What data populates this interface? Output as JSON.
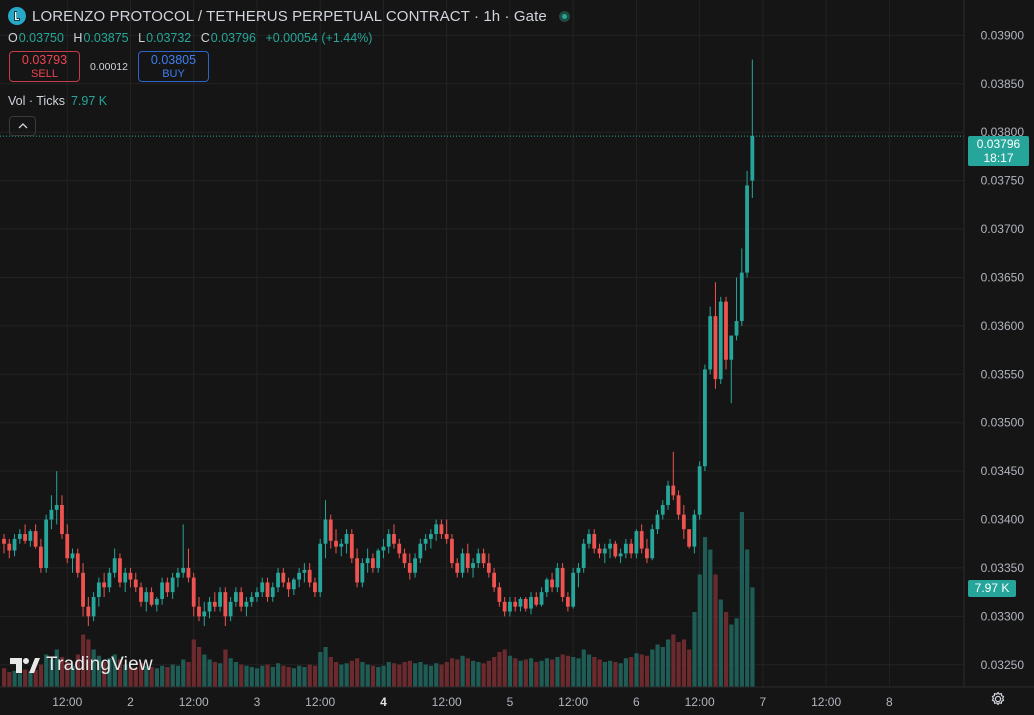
{
  "header": {
    "title": "LORENZO PROTOCOL / TETHERUS PERPETUAL CONTRACT · 1h · Gate"
  },
  "ohlc": {
    "o_label": "O",
    "o": "0.03750",
    "h_label": "H",
    "h": "0.03875",
    "l_label": "L",
    "l": "0.03732",
    "c_label": "C",
    "c": "0.03796",
    "change": "+0.00054 (+1.44%)"
  },
  "trade": {
    "sell_price": "0.03793",
    "sell_label": "SELL",
    "spread": "0.00012",
    "buy_price": "0.03805",
    "buy_label": "BUY"
  },
  "volume_legend": {
    "label": "Vol · Ticks",
    "value": "7.97 K"
  },
  "price_badge": {
    "price": "0.03796",
    "countdown": "18:17"
  },
  "volume_badge": "7.97 K",
  "brand": "TradingView",
  "colors": {
    "up": "#26a69a",
    "down": "#ef5350",
    "background": "#151515",
    "grid": "#232323"
  },
  "icons": [
    "logo-icon",
    "live-status-icon",
    "collapse-chevron-icon",
    "tradingview-logo-icon",
    "settings-gear-icon"
  ],
  "chart_data": {
    "type": "candlestick",
    "interval": "1h",
    "y_axis": {
      "ticks": [
        "0.03250",
        "0.03300",
        "0.03350",
        "0.03400",
        "0.03450",
        "0.03500",
        "0.03550",
        "0.03600",
        "0.03650",
        "0.03700",
        "0.03750",
        "0.03800",
        "0.03850",
        "0.03900"
      ],
      "range": [
        0.0321,
        0.0392
      ]
    },
    "x_axis": {
      "ticks": [
        {
          "label": "12:00",
          "bar": 12
        },
        {
          "label": "2",
          "bar": 24
        },
        {
          "label": "12:00",
          "bar": 36
        },
        {
          "label": "3",
          "bar": 48
        },
        {
          "label": "12:00",
          "bar": 60
        },
        {
          "label": "4",
          "bar": 72
        },
        {
          "label": "12:00",
          "bar": 84
        },
        {
          "label": "5",
          "bar": 96
        },
        {
          "label": "12:00",
          "bar": 108
        },
        {
          "label": "6",
          "bar": 120
        },
        {
          "label": "12:00",
          "bar": 132
        },
        {
          "label": "7",
          "bar": 144
        },
        {
          "label": "12:00",
          "bar": 156
        },
        {
          "label": "8",
          "bar": 168
        }
      ],
      "bold_tick": "4"
    },
    "grid": true,
    "last_price": 0.03796,
    "series": [
      {
        "o": 0.0338,
        "h": 0.03385,
        "l": 0.03365,
        "c": 0.03375,
        "v": 150
      },
      {
        "o": 0.03375,
        "h": 0.0338,
        "l": 0.0336,
        "c": 0.03368,
        "v": 120
      },
      {
        "o": 0.03368,
        "h": 0.03385,
        "l": 0.03362,
        "c": 0.0338,
        "v": 130
      },
      {
        "o": 0.0338,
        "h": 0.0339,
        "l": 0.03375,
        "c": 0.03385,
        "v": 110
      },
      {
        "o": 0.03385,
        "h": 0.03395,
        "l": 0.03375,
        "c": 0.03378,
        "v": 140
      },
      {
        "o": 0.03378,
        "h": 0.0339,
        "l": 0.03372,
        "c": 0.03388,
        "v": 125
      },
      {
        "o": 0.03388,
        "h": 0.03395,
        "l": 0.0337,
        "c": 0.03372,
        "v": 135
      },
      {
        "o": 0.03372,
        "h": 0.0338,
        "l": 0.03345,
        "c": 0.0335,
        "v": 180
      },
      {
        "o": 0.0335,
        "h": 0.03405,
        "l": 0.03345,
        "c": 0.034,
        "v": 260
      },
      {
        "o": 0.034,
        "h": 0.03425,
        "l": 0.0339,
        "c": 0.0341,
        "v": 220
      },
      {
        "o": 0.0341,
        "h": 0.0345,
        "l": 0.03395,
        "c": 0.03415,
        "v": 300
      },
      {
        "o": 0.03415,
        "h": 0.03425,
        "l": 0.0338,
        "c": 0.03385,
        "v": 240
      },
      {
        "o": 0.03385,
        "h": 0.03395,
        "l": 0.03355,
        "c": 0.0336,
        "v": 200
      },
      {
        "o": 0.0336,
        "h": 0.0337,
        "l": 0.03345,
        "c": 0.03365,
        "v": 170
      },
      {
        "o": 0.03365,
        "h": 0.0337,
        "l": 0.0334,
        "c": 0.03345,
        "v": 260
      },
      {
        "o": 0.03345,
        "h": 0.03355,
        "l": 0.033,
        "c": 0.0331,
        "v": 420
      },
      {
        "o": 0.0331,
        "h": 0.0332,
        "l": 0.0329,
        "c": 0.033,
        "v": 380
      },
      {
        "o": 0.033,
        "h": 0.03325,
        "l": 0.03295,
        "c": 0.0332,
        "v": 300
      },
      {
        "o": 0.0332,
        "h": 0.0334,
        "l": 0.0331,
        "c": 0.03335,
        "v": 250
      },
      {
        "o": 0.03335,
        "h": 0.03345,
        "l": 0.0332,
        "c": 0.0333,
        "v": 200
      },
      {
        "o": 0.0333,
        "h": 0.0335,
        "l": 0.03325,
        "c": 0.03345,
        "v": 230
      },
      {
        "o": 0.03345,
        "h": 0.0337,
        "l": 0.0334,
        "c": 0.0336,
        "v": 260
      },
      {
        "o": 0.0336,
        "h": 0.03365,
        "l": 0.0333,
        "c": 0.03335,
        "v": 220
      },
      {
        "o": 0.03335,
        "h": 0.0335,
        "l": 0.03325,
        "c": 0.03345,
        "v": 180
      },
      {
        "o": 0.03345,
        "h": 0.0335,
        "l": 0.0333,
        "c": 0.03338,
        "v": 160
      },
      {
        "o": 0.03338,
        "h": 0.03345,
        "l": 0.03325,
        "c": 0.0333,
        "v": 150
      },
      {
        "o": 0.0333,
        "h": 0.03335,
        "l": 0.0331,
        "c": 0.03315,
        "v": 190
      },
      {
        "o": 0.03315,
        "h": 0.0333,
        "l": 0.03305,
        "c": 0.03325,
        "v": 170
      },
      {
        "o": 0.03325,
        "h": 0.0333,
        "l": 0.0331,
        "c": 0.03312,
        "v": 160
      },
      {
        "o": 0.03312,
        "h": 0.0332,
        "l": 0.03305,
        "c": 0.03318,
        "v": 150
      },
      {
        "o": 0.03318,
        "h": 0.0334,
        "l": 0.03312,
        "c": 0.03335,
        "v": 170
      },
      {
        "o": 0.03335,
        "h": 0.0334,
        "l": 0.0332,
        "c": 0.03325,
        "v": 160
      },
      {
        "o": 0.03325,
        "h": 0.03345,
        "l": 0.03318,
        "c": 0.0334,
        "v": 180
      },
      {
        "o": 0.0334,
        "h": 0.0335,
        "l": 0.0333,
        "c": 0.03345,
        "v": 170
      },
      {
        "o": 0.03345,
        "h": 0.03395,
        "l": 0.0334,
        "c": 0.0335,
        "v": 220
      },
      {
        "o": 0.0335,
        "h": 0.0337,
        "l": 0.03335,
        "c": 0.0334,
        "v": 200
      },
      {
        "o": 0.0334,
        "h": 0.03345,
        "l": 0.033,
        "c": 0.0331,
        "v": 380
      },
      {
        "o": 0.0331,
        "h": 0.0332,
        "l": 0.03295,
        "c": 0.033,
        "v": 320
      },
      {
        "o": 0.033,
        "h": 0.03315,
        "l": 0.0329,
        "c": 0.03305,
        "v": 260
      },
      {
        "o": 0.03305,
        "h": 0.0332,
        "l": 0.03298,
        "c": 0.03315,
        "v": 220
      },
      {
        "o": 0.03315,
        "h": 0.03325,
        "l": 0.03305,
        "c": 0.0331,
        "v": 200
      },
      {
        "o": 0.0331,
        "h": 0.0333,
        "l": 0.03305,
        "c": 0.03325,
        "v": 190
      },
      {
        "o": 0.03325,
        "h": 0.0333,
        "l": 0.0329,
        "c": 0.033,
        "v": 300
      },
      {
        "o": 0.033,
        "h": 0.0332,
        "l": 0.03295,
        "c": 0.03315,
        "v": 230
      },
      {
        "o": 0.03315,
        "h": 0.0333,
        "l": 0.0331,
        "c": 0.03325,
        "v": 200
      },
      {
        "o": 0.03325,
        "h": 0.0333,
        "l": 0.03305,
        "c": 0.0331,
        "v": 180
      },
      {
        "o": 0.0331,
        "h": 0.0332,
        "l": 0.033,
        "c": 0.03315,
        "v": 170
      },
      {
        "o": 0.03315,
        "h": 0.03325,
        "l": 0.0331,
        "c": 0.0332,
        "v": 160
      },
      {
        "o": 0.0332,
        "h": 0.0333,
        "l": 0.03315,
        "c": 0.03325,
        "v": 150
      },
      {
        "o": 0.03325,
        "h": 0.0334,
        "l": 0.0332,
        "c": 0.03335,
        "v": 170
      },
      {
        "o": 0.03335,
        "h": 0.0334,
        "l": 0.03315,
        "c": 0.0332,
        "v": 180
      },
      {
        "o": 0.0332,
        "h": 0.03335,
        "l": 0.03315,
        "c": 0.0333,
        "v": 160
      },
      {
        "o": 0.0333,
        "h": 0.0335,
        "l": 0.03325,
        "c": 0.03345,
        "v": 190
      },
      {
        "o": 0.03345,
        "h": 0.0335,
        "l": 0.0333,
        "c": 0.03335,
        "v": 170
      },
      {
        "o": 0.03335,
        "h": 0.0334,
        "l": 0.0332,
        "c": 0.03328,
        "v": 160
      },
      {
        "o": 0.03328,
        "h": 0.0334,
        "l": 0.03322,
        "c": 0.03338,
        "v": 150
      },
      {
        "o": 0.03338,
        "h": 0.0335,
        "l": 0.0333,
        "c": 0.03345,
        "v": 170
      },
      {
        "o": 0.03345,
        "h": 0.03355,
        "l": 0.03335,
        "c": 0.03348,
        "v": 160
      },
      {
        "o": 0.03348,
        "h": 0.03355,
        "l": 0.0333,
        "c": 0.03335,
        "v": 180
      },
      {
        "o": 0.03335,
        "h": 0.0334,
        "l": 0.0332,
        "c": 0.03325,
        "v": 170
      },
      {
        "o": 0.03325,
        "h": 0.0338,
        "l": 0.0332,
        "c": 0.03375,
        "v": 280
      },
      {
        "o": 0.03375,
        "h": 0.0342,
        "l": 0.0336,
        "c": 0.034,
        "v": 320
      },
      {
        "o": 0.034,
        "h": 0.03405,
        "l": 0.0337,
        "c": 0.03378,
        "v": 240
      },
      {
        "o": 0.03378,
        "h": 0.0339,
        "l": 0.03365,
        "c": 0.03372,
        "v": 200
      },
      {
        "o": 0.03372,
        "h": 0.0338,
        "l": 0.03362,
        "c": 0.03375,
        "v": 180
      },
      {
        "o": 0.03375,
        "h": 0.0339,
        "l": 0.03365,
        "c": 0.03385,
        "v": 190
      },
      {
        "o": 0.03385,
        "h": 0.0339,
        "l": 0.03355,
        "c": 0.0336,
        "v": 210
      },
      {
        "o": 0.0336,
        "h": 0.0337,
        "l": 0.0333,
        "c": 0.03335,
        "v": 230
      },
      {
        "o": 0.03335,
        "h": 0.0336,
        "l": 0.0333,
        "c": 0.03355,
        "v": 200
      },
      {
        "o": 0.03355,
        "h": 0.0337,
        "l": 0.03345,
        "c": 0.0336,
        "v": 180
      },
      {
        "o": 0.0336,
        "h": 0.03365,
        "l": 0.03345,
        "c": 0.0335,
        "v": 170
      },
      {
        "o": 0.0335,
        "h": 0.0337,
        "l": 0.03345,
        "c": 0.03368,
        "v": 160
      },
      {
        "o": 0.03368,
        "h": 0.0338,
        "l": 0.0336,
        "c": 0.03372,
        "v": 170
      },
      {
        "o": 0.03372,
        "h": 0.0339,
        "l": 0.03365,
        "c": 0.03385,
        "v": 200
      },
      {
        "o": 0.03385,
        "h": 0.03395,
        "l": 0.0337,
        "c": 0.03375,
        "v": 190
      },
      {
        "o": 0.03375,
        "h": 0.0338,
        "l": 0.0336,
        "c": 0.03365,
        "v": 180
      },
      {
        "o": 0.03365,
        "h": 0.0337,
        "l": 0.0335,
        "c": 0.03355,
        "v": 200
      },
      {
        "o": 0.03355,
        "h": 0.03365,
        "l": 0.03338,
        "c": 0.03345,
        "v": 210
      },
      {
        "o": 0.03345,
        "h": 0.03365,
        "l": 0.0334,
        "c": 0.0336,
        "v": 190
      },
      {
        "o": 0.0336,
        "h": 0.0338,
        "l": 0.03355,
        "c": 0.03375,
        "v": 200
      },
      {
        "o": 0.03375,
        "h": 0.03385,
        "l": 0.03368,
        "c": 0.0338,
        "v": 180
      },
      {
        "o": 0.0338,
        "h": 0.0339,
        "l": 0.0337,
        "c": 0.03385,
        "v": 170
      },
      {
        "o": 0.03385,
        "h": 0.034,
        "l": 0.03378,
        "c": 0.03395,
        "v": 190
      },
      {
        "o": 0.03395,
        "h": 0.034,
        "l": 0.0338,
        "c": 0.03385,
        "v": 180
      },
      {
        "o": 0.03385,
        "h": 0.034,
        "l": 0.03375,
        "c": 0.0338,
        "v": 200
      },
      {
        "o": 0.0338,
        "h": 0.03385,
        "l": 0.0335,
        "c": 0.03355,
        "v": 230
      },
      {
        "o": 0.03355,
        "h": 0.0336,
        "l": 0.0334,
        "c": 0.03345,
        "v": 220
      },
      {
        "o": 0.03345,
        "h": 0.0337,
        "l": 0.0334,
        "c": 0.03365,
        "v": 250
      },
      {
        "o": 0.03365,
        "h": 0.03375,
        "l": 0.03345,
        "c": 0.0335,
        "v": 230
      },
      {
        "o": 0.0335,
        "h": 0.0336,
        "l": 0.0334,
        "c": 0.03355,
        "v": 210
      },
      {
        "o": 0.03355,
        "h": 0.0337,
        "l": 0.0335,
        "c": 0.03365,
        "v": 200
      },
      {
        "o": 0.03365,
        "h": 0.0337,
        "l": 0.0335,
        "c": 0.03355,
        "v": 190
      },
      {
        "o": 0.03355,
        "h": 0.03365,
        "l": 0.0334,
        "c": 0.03345,
        "v": 210
      },
      {
        "o": 0.03345,
        "h": 0.0335,
        "l": 0.03325,
        "c": 0.0333,
        "v": 240
      },
      {
        "o": 0.0333,
        "h": 0.03335,
        "l": 0.0331,
        "c": 0.03315,
        "v": 280
      },
      {
        "o": 0.03315,
        "h": 0.0332,
        "l": 0.033,
        "c": 0.03305,
        "v": 300
      },
      {
        "o": 0.03305,
        "h": 0.0332,
        "l": 0.033,
        "c": 0.03315,
        "v": 250
      },
      {
        "o": 0.03315,
        "h": 0.0332,
        "l": 0.03305,
        "c": 0.0331,
        "v": 230
      },
      {
        "o": 0.0331,
        "h": 0.0332,
        "l": 0.03305,
        "c": 0.03318,
        "v": 210
      },
      {
        "o": 0.03318,
        "h": 0.0332,
        "l": 0.03305,
        "c": 0.03308,
        "v": 220
      },
      {
        "o": 0.03308,
        "h": 0.03325,
        "l": 0.03302,
        "c": 0.0332,
        "v": 230
      },
      {
        "o": 0.0332,
        "h": 0.03325,
        "l": 0.0331,
        "c": 0.03312,
        "v": 200
      },
      {
        "o": 0.03312,
        "h": 0.0333,
        "l": 0.0331,
        "c": 0.03325,
        "v": 210
      },
      {
        "o": 0.03325,
        "h": 0.0334,
        "l": 0.0332,
        "c": 0.03338,
        "v": 230
      },
      {
        "o": 0.03338,
        "h": 0.03345,
        "l": 0.03325,
        "c": 0.0333,
        "v": 220
      },
      {
        "o": 0.0333,
        "h": 0.03355,
        "l": 0.03325,
        "c": 0.0335,
        "v": 240
      },
      {
        "o": 0.0335,
        "h": 0.03355,
        "l": 0.03315,
        "c": 0.0332,
        "v": 260
      },
      {
        "o": 0.0332,
        "h": 0.03325,
        "l": 0.03305,
        "c": 0.0331,
        "v": 250
      },
      {
        "o": 0.0331,
        "h": 0.0335,
        "l": 0.03308,
        "c": 0.03345,
        "v": 240
      },
      {
        "o": 0.03345,
        "h": 0.03355,
        "l": 0.0333,
        "c": 0.0335,
        "v": 230
      },
      {
        "o": 0.0335,
        "h": 0.0338,
        "l": 0.03345,
        "c": 0.03375,
        "v": 300
      },
      {
        "o": 0.03375,
        "h": 0.0339,
        "l": 0.0337,
        "c": 0.03385,
        "v": 260
      },
      {
        "o": 0.03385,
        "h": 0.0339,
        "l": 0.03365,
        "c": 0.0337,
        "v": 240
      },
      {
        "o": 0.0337,
        "h": 0.03375,
        "l": 0.0336,
        "c": 0.03365,
        "v": 220
      },
      {
        "o": 0.03365,
        "h": 0.03375,
        "l": 0.03355,
        "c": 0.0337,
        "v": 200
      },
      {
        "o": 0.0337,
        "h": 0.0338,
        "l": 0.0336,
        "c": 0.03375,
        "v": 210
      },
      {
        "o": 0.03375,
        "h": 0.03378,
        "l": 0.0336,
        "c": 0.03362,
        "v": 200
      },
      {
        "o": 0.03362,
        "h": 0.0337,
        "l": 0.03355,
        "c": 0.03365,
        "v": 190
      },
      {
        "o": 0.03365,
        "h": 0.0338,
        "l": 0.0336,
        "c": 0.03375,
        "v": 230
      },
      {
        "o": 0.03375,
        "h": 0.0338,
        "l": 0.0336,
        "c": 0.03365,
        "v": 240
      },
      {
        "o": 0.03365,
        "h": 0.0339,
        "l": 0.0336,
        "c": 0.03388,
        "v": 270
      },
      {
        "o": 0.03388,
        "h": 0.03395,
        "l": 0.03365,
        "c": 0.0337,
        "v": 260
      },
      {
        "o": 0.0337,
        "h": 0.0338,
        "l": 0.03355,
        "c": 0.0336,
        "v": 250
      },
      {
        "o": 0.0336,
        "h": 0.03395,
        "l": 0.03358,
        "c": 0.0339,
        "v": 300
      },
      {
        "o": 0.0339,
        "h": 0.0341,
        "l": 0.03385,
        "c": 0.03405,
        "v": 340
      },
      {
        "o": 0.03405,
        "h": 0.0342,
        "l": 0.034,
        "c": 0.03415,
        "v": 320
      },
      {
        "o": 0.03415,
        "h": 0.0344,
        "l": 0.0341,
        "c": 0.03435,
        "v": 380
      },
      {
        "o": 0.03435,
        "h": 0.0347,
        "l": 0.0342,
        "c": 0.03425,
        "v": 420
      },
      {
        "o": 0.03425,
        "h": 0.0343,
        "l": 0.034,
        "c": 0.03405,
        "v": 360
      },
      {
        "o": 0.03405,
        "h": 0.03415,
        "l": 0.0338,
        "c": 0.0339,
        "v": 380
      },
      {
        "o": 0.0339,
        "h": 0.0339,
        "l": 0.0337,
        "c": 0.03372,
        "v": 300
      },
      {
        "o": 0.03372,
        "h": 0.0341,
        "l": 0.03365,
        "c": 0.03405,
        "v": 600
      },
      {
        "o": 0.03405,
        "h": 0.0346,
        "l": 0.034,
        "c": 0.03455,
        "v": 900
      },
      {
        "o": 0.03455,
        "h": 0.0356,
        "l": 0.0345,
        "c": 0.03555,
        "v": 1200
      },
      {
        "o": 0.03555,
        "h": 0.0362,
        "l": 0.0355,
        "c": 0.0361,
        "v": 1100
      },
      {
        "o": 0.0361,
        "h": 0.03645,
        "l": 0.03535,
        "c": 0.03545,
        "v": 900
      },
      {
        "o": 0.03545,
        "h": 0.0363,
        "l": 0.0354,
        "c": 0.03625,
        "v": 700
      },
      {
        "o": 0.03625,
        "h": 0.0363,
        "l": 0.03555,
        "c": 0.03565,
        "v": 600
      },
      {
        "o": 0.03565,
        "h": 0.0357,
        "l": 0.0352,
        "c": 0.0359,
        "v": 500
      },
      {
        "o": 0.0359,
        "h": 0.0365,
        "l": 0.03585,
        "c": 0.03605,
        "v": 550
      },
      {
        "o": 0.03605,
        "h": 0.0368,
        "l": 0.036,
        "c": 0.03655,
        "v": 1400
      },
      {
        "o": 0.03655,
        "h": 0.0376,
        "l": 0.0365,
        "c": 0.03745,
        "v": 1100
      },
      {
        "o": 0.0375,
        "h": 0.03875,
        "l": 0.03732,
        "c": 0.03796,
        "v": 797
      }
    ]
  }
}
